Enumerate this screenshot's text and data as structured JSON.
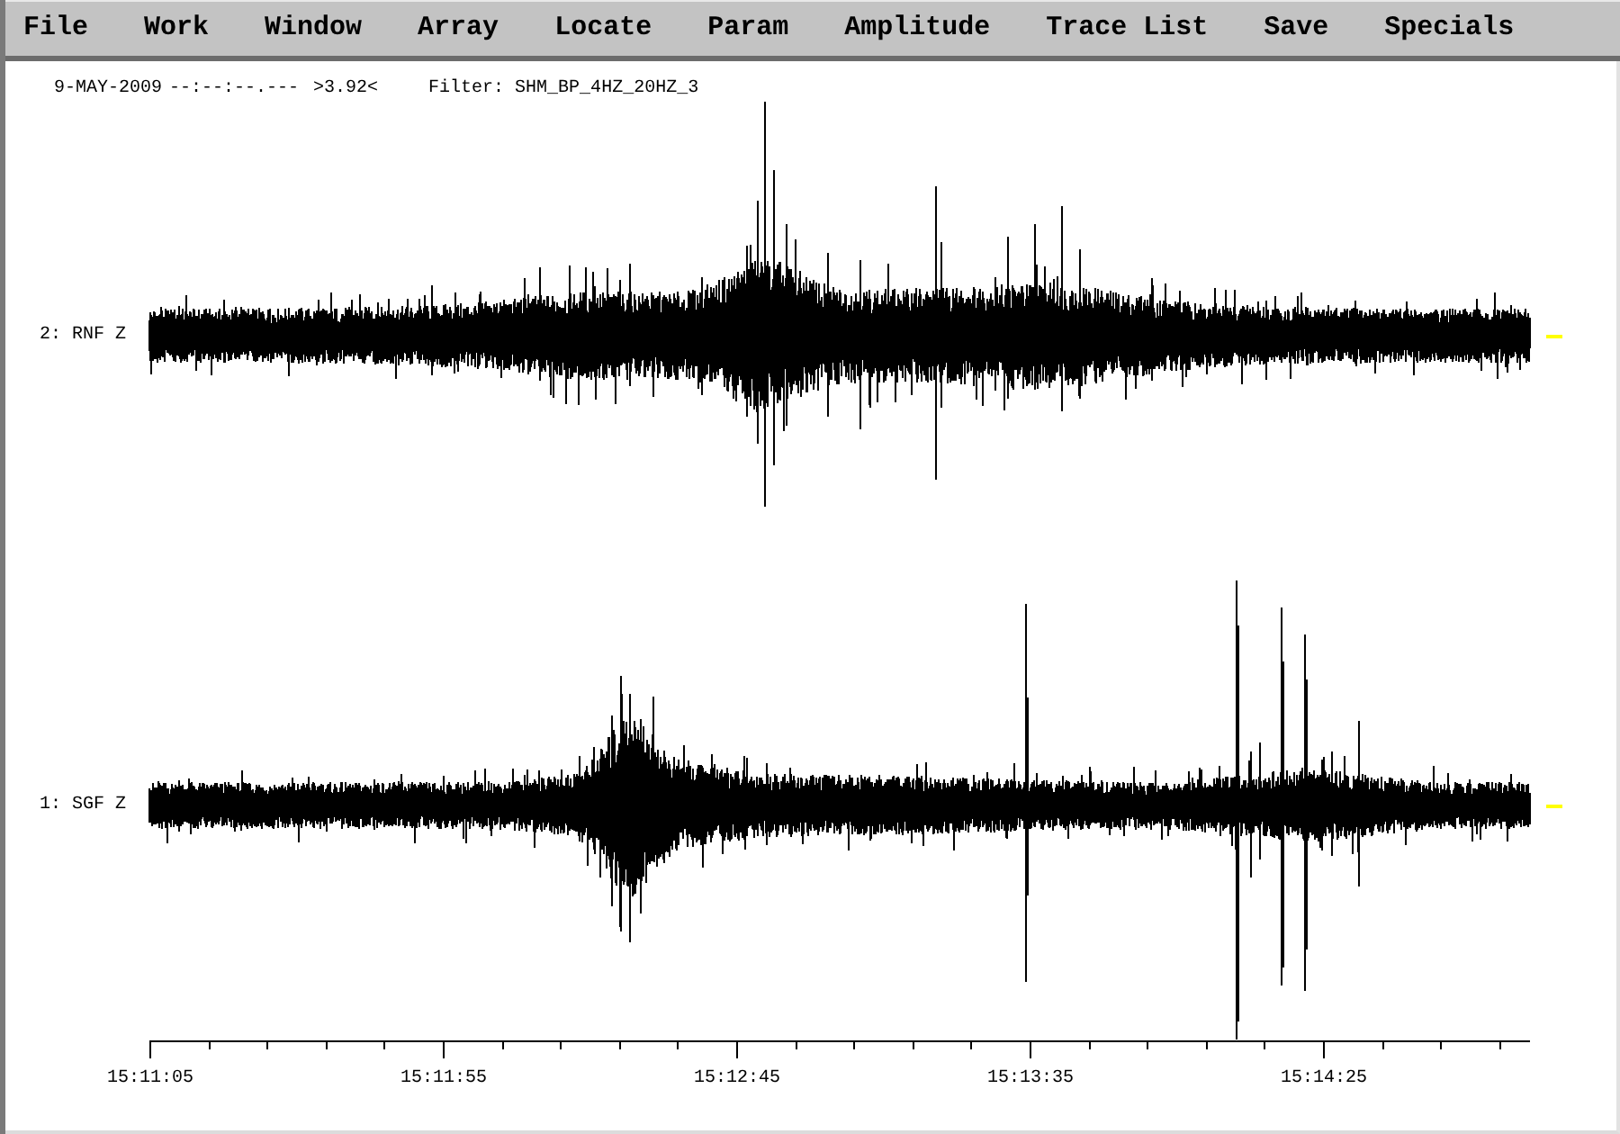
{
  "menu_bar": {
    "items": [
      "File",
      "Work",
      "Window",
      "Array",
      "Locate",
      "Param",
      "Amplitude",
      "Trace List",
      "Save",
      "Specials"
    ]
  },
  "header": {
    "date": "9-MAY-2009",
    "time": "--:--:--.---",
    "scale": ">3.92<",
    "filter": "Filter: SHM_BP_4HZ_20HZ_3"
  },
  "traces": [
    {
      "label": "2: RNF Z"
    },
    {
      "label": "1: SGF Z"
    }
  ],
  "time_axis": {
    "tick_labels": [
      "15:11:05",
      "15:11:55",
      "15:12:45",
      "15:13:35",
      "15:14:25"
    ]
  }
}
